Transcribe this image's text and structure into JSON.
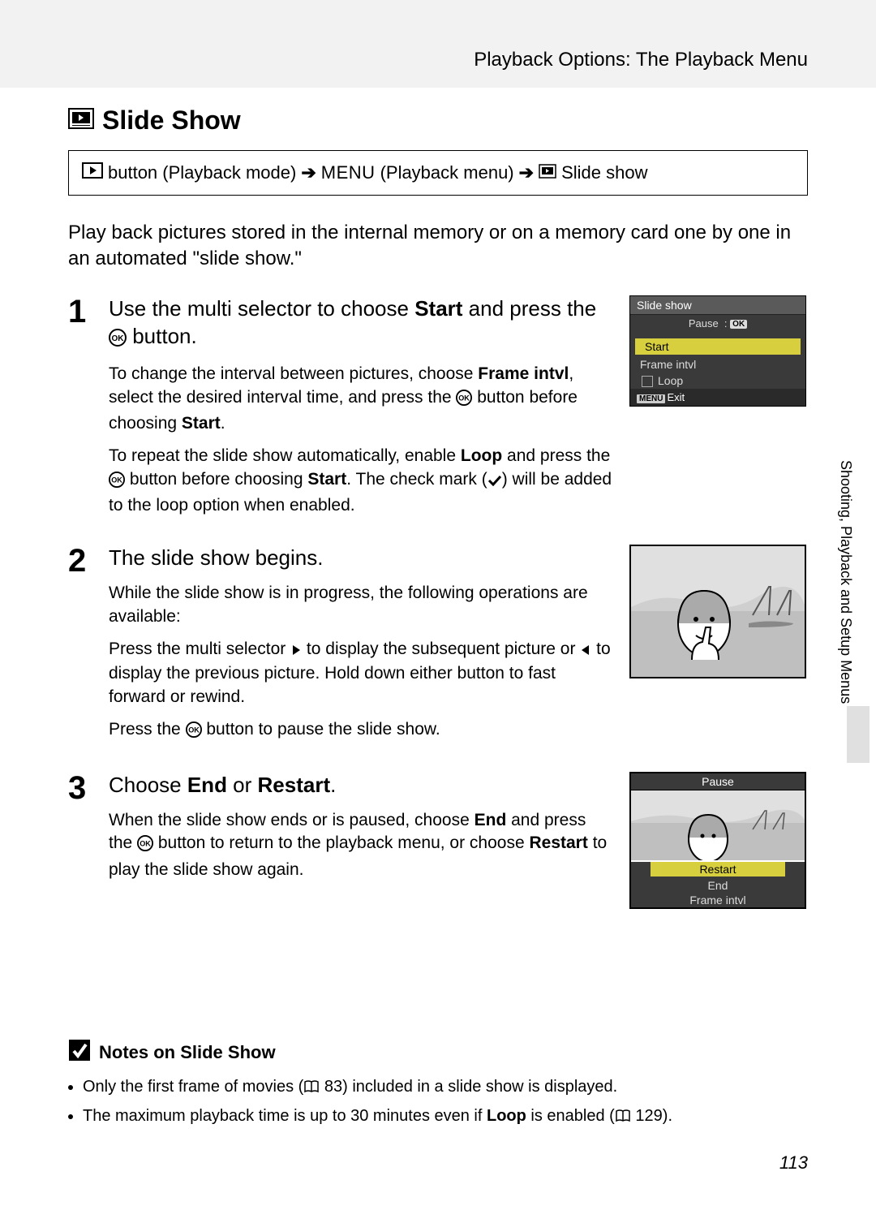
{
  "header": {
    "breadcrumb": "Playback Options: The Playback Menu"
  },
  "title": "Slide Show",
  "nav_path": {
    "part1": "button (Playback mode)",
    "menu_word": "MENU",
    "part2": "(Playback menu)",
    "part3": "Slide show"
  },
  "intro": "Play back pictures stored in the internal memory or on a memory card one by one in an automated \"slide show.\"",
  "steps": [
    {
      "num": "1",
      "head_pre": "Use the multi selector to choose ",
      "head_bold1": "Start",
      "head_mid": " and press the ",
      "head_post": " button.",
      "p1_pre": "To change the interval between pictures, choose ",
      "p1_b1": "Frame intvl",
      "p1_mid": ", select the desired interval time, and press the ",
      "p1_post": " button before choosing ",
      "p1_b2": "Start",
      "p1_end": ".",
      "p2_pre": "To repeat the slide show automatically, enable ",
      "p2_b1": "Loop",
      "p2_mid": " and press the ",
      "p2_mid2": " button before choosing ",
      "p2_b2": "Start",
      "p2_mid3": ". The check mark (",
      "p2_post": ") will be added to the loop option when enabled."
    },
    {
      "num": "2",
      "head": "The slide show begins.",
      "p1": "While the slide show is in progress, the following operations are available:",
      "p2_pre": "Press the multi selector ",
      "p2_mid": " to display the subsequent picture or ",
      "p2_post": " to display the previous picture. Hold down either button to fast forward or rewind.",
      "p3_pre": "Press the ",
      "p3_post": " button to pause the slide show."
    },
    {
      "num": "3",
      "head_pre": "Choose ",
      "head_b1": "End",
      "head_mid": " or ",
      "head_b2": "Restart",
      "head_post": ".",
      "p1_pre": "When the slide show ends or is paused, choose ",
      "p1_b1": "End",
      "p1_mid": " and press the ",
      "p1_mid2": " button to return to the playback menu, or choose ",
      "p1_b2": "Restart",
      "p1_post": " to play the slide show again."
    }
  ],
  "screens": {
    "screen1": {
      "title": "Slide show",
      "pause": "Pause",
      "ok": "OK",
      "items": [
        "Start",
        "Frame intvl",
        "Loop"
      ],
      "exit_prefix": "MENU",
      "exit": "Exit"
    },
    "screen3": {
      "title": "Pause",
      "items": [
        "Restart",
        "End",
        "Frame intvl"
      ]
    }
  },
  "side_tab": "Shooting, Playback and Setup Menus",
  "notes": {
    "heading": "Notes on Slide Show",
    "items": [
      {
        "pre": "Only the first frame of movies (",
        "ref": "83",
        "post": ") included in a slide show is displayed."
      },
      {
        "pre": "The maximum playback time is up to 30 minutes even if ",
        "bold": "Loop",
        "mid": " is enabled (",
        "ref": "129",
        "post": ")."
      }
    ]
  },
  "page_number": "113"
}
